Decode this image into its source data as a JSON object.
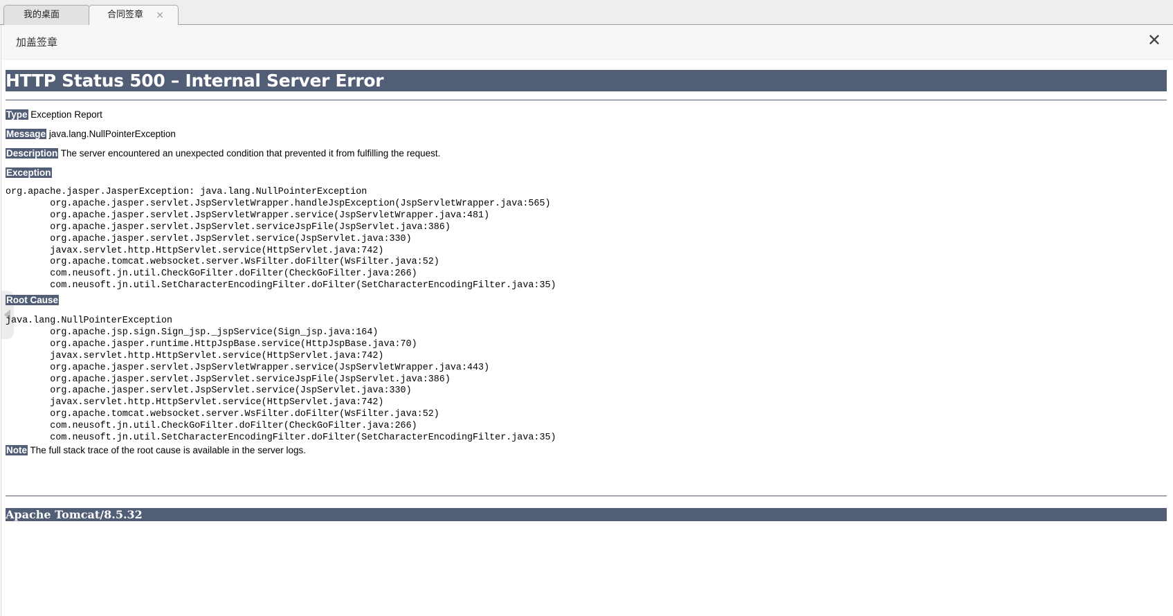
{
  "tabs": [
    {
      "label": "我的桌面",
      "active": false
    },
    {
      "label": "合同签章",
      "active": true,
      "close": "×"
    }
  ],
  "panel": {
    "title": "加盖签章",
    "close": "✕"
  },
  "error": {
    "heading": "HTTP Status 500 – Internal Server Error",
    "type_label": "Type",
    "type_value": "Exception Report",
    "message_label": "Message",
    "message_value": "java.lang.NullPointerException",
    "description_label": "Description",
    "description_value": "The server encountered an unexpected condition that prevented it from fulfilling the request.",
    "exception_label": "Exception",
    "exception_trace": "org.apache.jasper.JasperException: java.lang.NullPointerException\n\torg.apache.jasper.servlet.JspServletWrapper.handleJspException(JspServletWrapper.java:565)\n\torg.apache.jasper.servlet.JspServletWrapper.service(JspServletWrapper.java:481)\n\torg.apache.jasper.servlet.JspServlet.serviceJspFile(JspServlet.java:386)\n\torg.apache.jasper.servlet.JspServlet.service(JspServlet.java:330)\n\tjavax.servlet.http.HttpServlet.service(HttpServlet.java:742)\n\torg.apache.tomcat.websocket.server.WsFilter.doFilter(WsFilter.java:52)\n\tcom.neusoft.jn.util.CheckGoFilter.doFilter(CheckGoFilter.java:266)\n\tcom.neusoft.jn.util.SetCharacterEncodingFilter.doFilter(SetCharacterEncodingFilter.java:35)",
    "root_cause_label": "Root Cause",
    "root_cause_trace": "java.lang.NullPointerException\n\torg.apache.jsp.sign.Sign_jsp._jspService(Sign_jsp.java:164)\n\torg.apache.jasper.runtime.HttpJspBase.service(HttpJspBase.java:70)\n\tjavax.servlet.http.HttpServlet.service(HttpServlet.java:742)\n\torg.apache.jasper.servlet.JspServletWrapper.service(JspServletWrapper.java:443)\n\torg.apache.jasper.servlet.JspServlet.serviceJspFile(JspServlet.java:386)\n\torg.apache.jasper.servlet.JspServlet.service(JspServlet.java:330)\n\tjavax.servlet.http.HttpServlet.service(HttpServlet.java:742)\n\torg.apache.tomcat.websocket.server.WsFilter.doFilter(WsFilter.java:52)\n\tcom.neusoft.jn.util.CheckGoFilter.doFilter(CheckGoFilter.java:266)\n\tcom.neusoft.jn.util.SetCharacterEncodingFilter.doFilter(SetCharacterEncodingFilter.java:35)",
    "note_label": "Note",
    "note_value": "The full stack trace of the root cause is available in the server logs.",
    "footer": "Apache Tomcat/8.5.32"
  },
  "colors": {
    "header_bar": "#525d76"
  }
}
